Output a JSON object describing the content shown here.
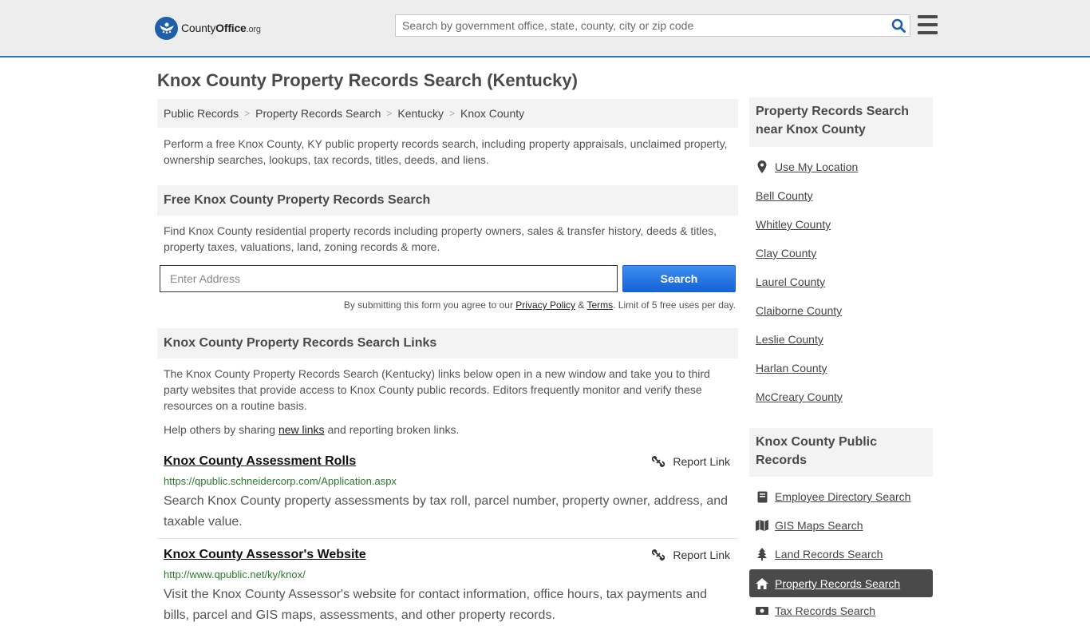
{
  "header": {
    "logo": {
      "part1": "County",
      "part2": "Office",
      "suffix": ".org"
    },
    "search_placeholder": "Search by government office, state, county, city or zip code"
  },
  "page_title": "Knox County Property Records Search (Kentucky)",
  "breadcrumb": [
    "Public Records",
    "Property Records Search",
    "Kentucky",
    "Knox County"
  ],
  "intro": "Perform a free Knox County, KY public property records search, including property appraisals, unclaimed property, ownership searches, lookups, tax records, titles, deeds, and liens.",
  "free_search": {
    "heading": "Free Knox County Property Records Search",
    "description": "Find Knox County residential property records including property owners, sales & transfer history, deeds & titles, property taxes, valuations, land, zoning records & more.",
    "address_placeholder": "Enter Address",
    "button": "Search",
    "terms_prefix": "By submitting this form you agree to our",
    "privacy": "Privacy Policy",
    "amp": "&",
    "terms": "Terms",
    "terms_suffix": ". Limit of 5 free uses per day."
  },
  "links_section": {
    "heading": "Knox County Property Records Search Links",
    "description": "The Knox County Property Records Search (Kentucky) links below open in a new window and take you to third party websites that provide access to Knox County public records. Editors frequently monitor and verify these resources on a routine basis.",
    "help_prefix": "Help others by sharing",
    "help_link": "new links",
    "help_suffix": "and reporting broken links.",
    "report_label": "Report Link",
    "items": [
      {
        "title": "Knox County Assessment Rolls",
        "url": "https://qpublic.schneidercorp.com/Application.aspx",
        "description": "Search Knox County property assessments by tax roll, parcel number, property owner, address, and taxable value."
      },
      {
        "title": "Knox County Assessor's Website",
        "url": "http://www.qpublic.net/ky/knox/",
        "description": "Visit the Knox County Assessor's website for contact information, office hours, tax payments and bills, parcel and GIS maps, assessments, and other property records."
      }
    ]
  },
  "sidebar": {
    "nearby_heading": "Property Records Search near Knox County",
    "use_location": "Use My Location",
    "nearby": [
      "Bell County",
      "Whitley County",
      "Clay County",
      "Laurel County",
      "Claiborne County",
      "Leslie County",
      "Harlan County",
      "McCreary County"
    ],
    "public_heading": "Knox County Public Records",
    "public_records": [
      {
        "label": "Employee Directory Search",
        "icon": "book-icon"
      },
      {
        "label": "GIS Maps Search",
        "icon": "map-icon"
      },
      {
        "label": "Land Records Search",
        "icon": "tree-icon"
      },
      {
        "label": "Property Records Search",
        "icon": "home-icon",
        "active": true
      },
      {
        "label": "Tax Records Search",
        "icon": "money-icon"
      }
    ]
  },
  "colors": {
    "accent": "#2a72c4",
    "url_green": "#2d7a2d",
    "active_bg": "#4a4a4a"
  }
}
